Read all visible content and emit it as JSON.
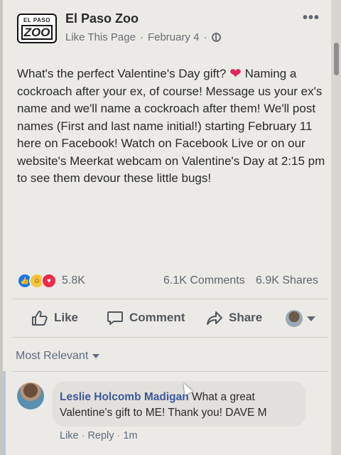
{
  "post": {
    "page_name": "El Paso Zoo",
    "logo_text_top": "EL PASO",
    "logo_text_main": "ZOO",
    "like_page_label": "Like This Page",
    "separator": "·",
    "date": "February 4",
    "privacy_icon": "globe-icon",
    "more_icon": "more-options-icon",
    "text_part1": "What's the perfect Valentine's Day gift?",
    "text_part2": "Naming a cockroach after your ex, of course! Message us your ex's name and we'll name a cockroach after them! We'll post names (First and last name initial!) starting February 11 here on Facebook! Watch on Facebook Live or on our website's Meerkat webcam on Valentine's Day at 2:15 pm to see them devour these little bugs!"
  },
  "stats": {
    "reactions": [
      "like",
      "haha",
      "love"
    ],
    "reaction_count": "5.8K",
    "comments": "6.1K Comments",
    "shares": "6.9K Shares"
  },
  "actions": {
    "like": "Like",
    "comment": "Comment",
    "share": "Share"
  },
  "comments": {
    "sort_label": "Most Relevant",
    "items": [
      {
        "author": "Leslie Holcomb Madigan",
        "text": "What a great Valentine's gift to ME! Thank you! DAVE M",
        "like": "Like",
        "reply": "Reply",
        "time": "1m"
      }
    ]
  },
  "colors": {
    "heart": "#e0245e",
    "link_blue": "#3b5998",
    "reaction_like": "#1877f2",
    "reaction_love": "#f0284a"
  }
}
